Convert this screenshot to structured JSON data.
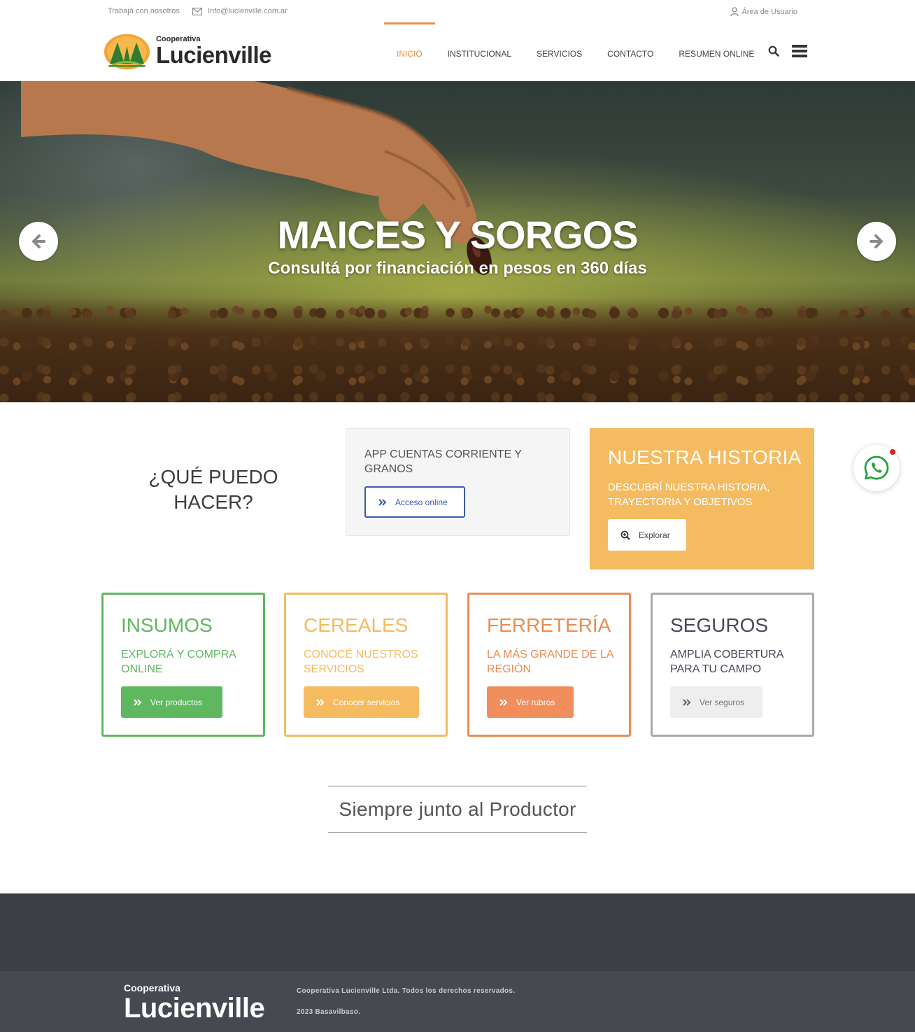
{
  "topbar": {
    "work_with_us": "Trabajá con nosotros",
    "email": "Info@lucienville.com.ar",
    "user_area": "Área de Usuario"
  },
  "brand": {
    "small": "Cooperativa",
    "name": "Lucienville"
  },
  "nav": {
    "items": [
      {
        "label": "INICIO",
        "active": true
      },
      {
        "label": "INSTITUCIONAL",
        "active": false
      },
      {
        "label": "SERVICIOS",
        "active": false
      },
      {
        "label": "CONTACTO",
        "active": false
      },
      {
        "label": "RESUMEN ONLINE",
        "active": false
      }
    ],
    "search_icon": "search-icon",
    "menu_icon": "hamburger-icon"
  },
  "hero": {
    "title": "MAICES Y SORGOS",
    "subtitle": "Consultá por financiación en pesos en 360 días"
  },
  "what_can_i_do": "¿QUÉ PUEDO HACER?",
  "app_box": {
    "title": "APP CUENTAS CORRIENTE Y GRANOS",
    "button": "Acceso online"
  },
  "history": {
    "title": "NUESTRA HISTORIA",
    "subtitle": "DESCUBRÍ NUESTRA HISTORIA, TRAYECTORIA Y OBJETIVOS",
    "button": "Explorar"
  },
  "cards": [
    {
      "title": "INSUMOS",
      "subtitle": "EXPLORÁ Y COMPRA ONLINE",
      "button": "Ver productos"
    },
    {
      "title": "CEREALES",
      "subtitle": "CONOCÉ NUESTROS SERVICIOS",
      "button": "Conocer servicios"
    },
    {
      "title": "FERRETERÍA",
      "subtitle": "LA MÁS GRANDE DE LA REGIÓN",
      "button": "Ver rubros"
    },
    {
      "title": "SEGUROS",
      "subtitle": "AMPLIA COBERTURA PARA TU CAMPO",
      "button": "Ver seguros"
    }
  ],
  "tagline": "Siempre junto al Productor",
  "footer": {
    "brand_small": "Cooperativa",
    "brand_name": "Lucienville",
    "copyright": "Cooperativa Lucienville Ltda. Todos los derechos reservados.",
    "year": "2023 Basavilbaso."
  },
  "colors": {
    "accent_orange": "#e8924a",
    "green": "#5fb760",
    "yellow": "#f5bb60",
    "orange": "#ea8c52",
    "gray": "#a9a9a9",
    "blue": "#3d5ba6",
    "footer": "#3c3f46"
  }
}
